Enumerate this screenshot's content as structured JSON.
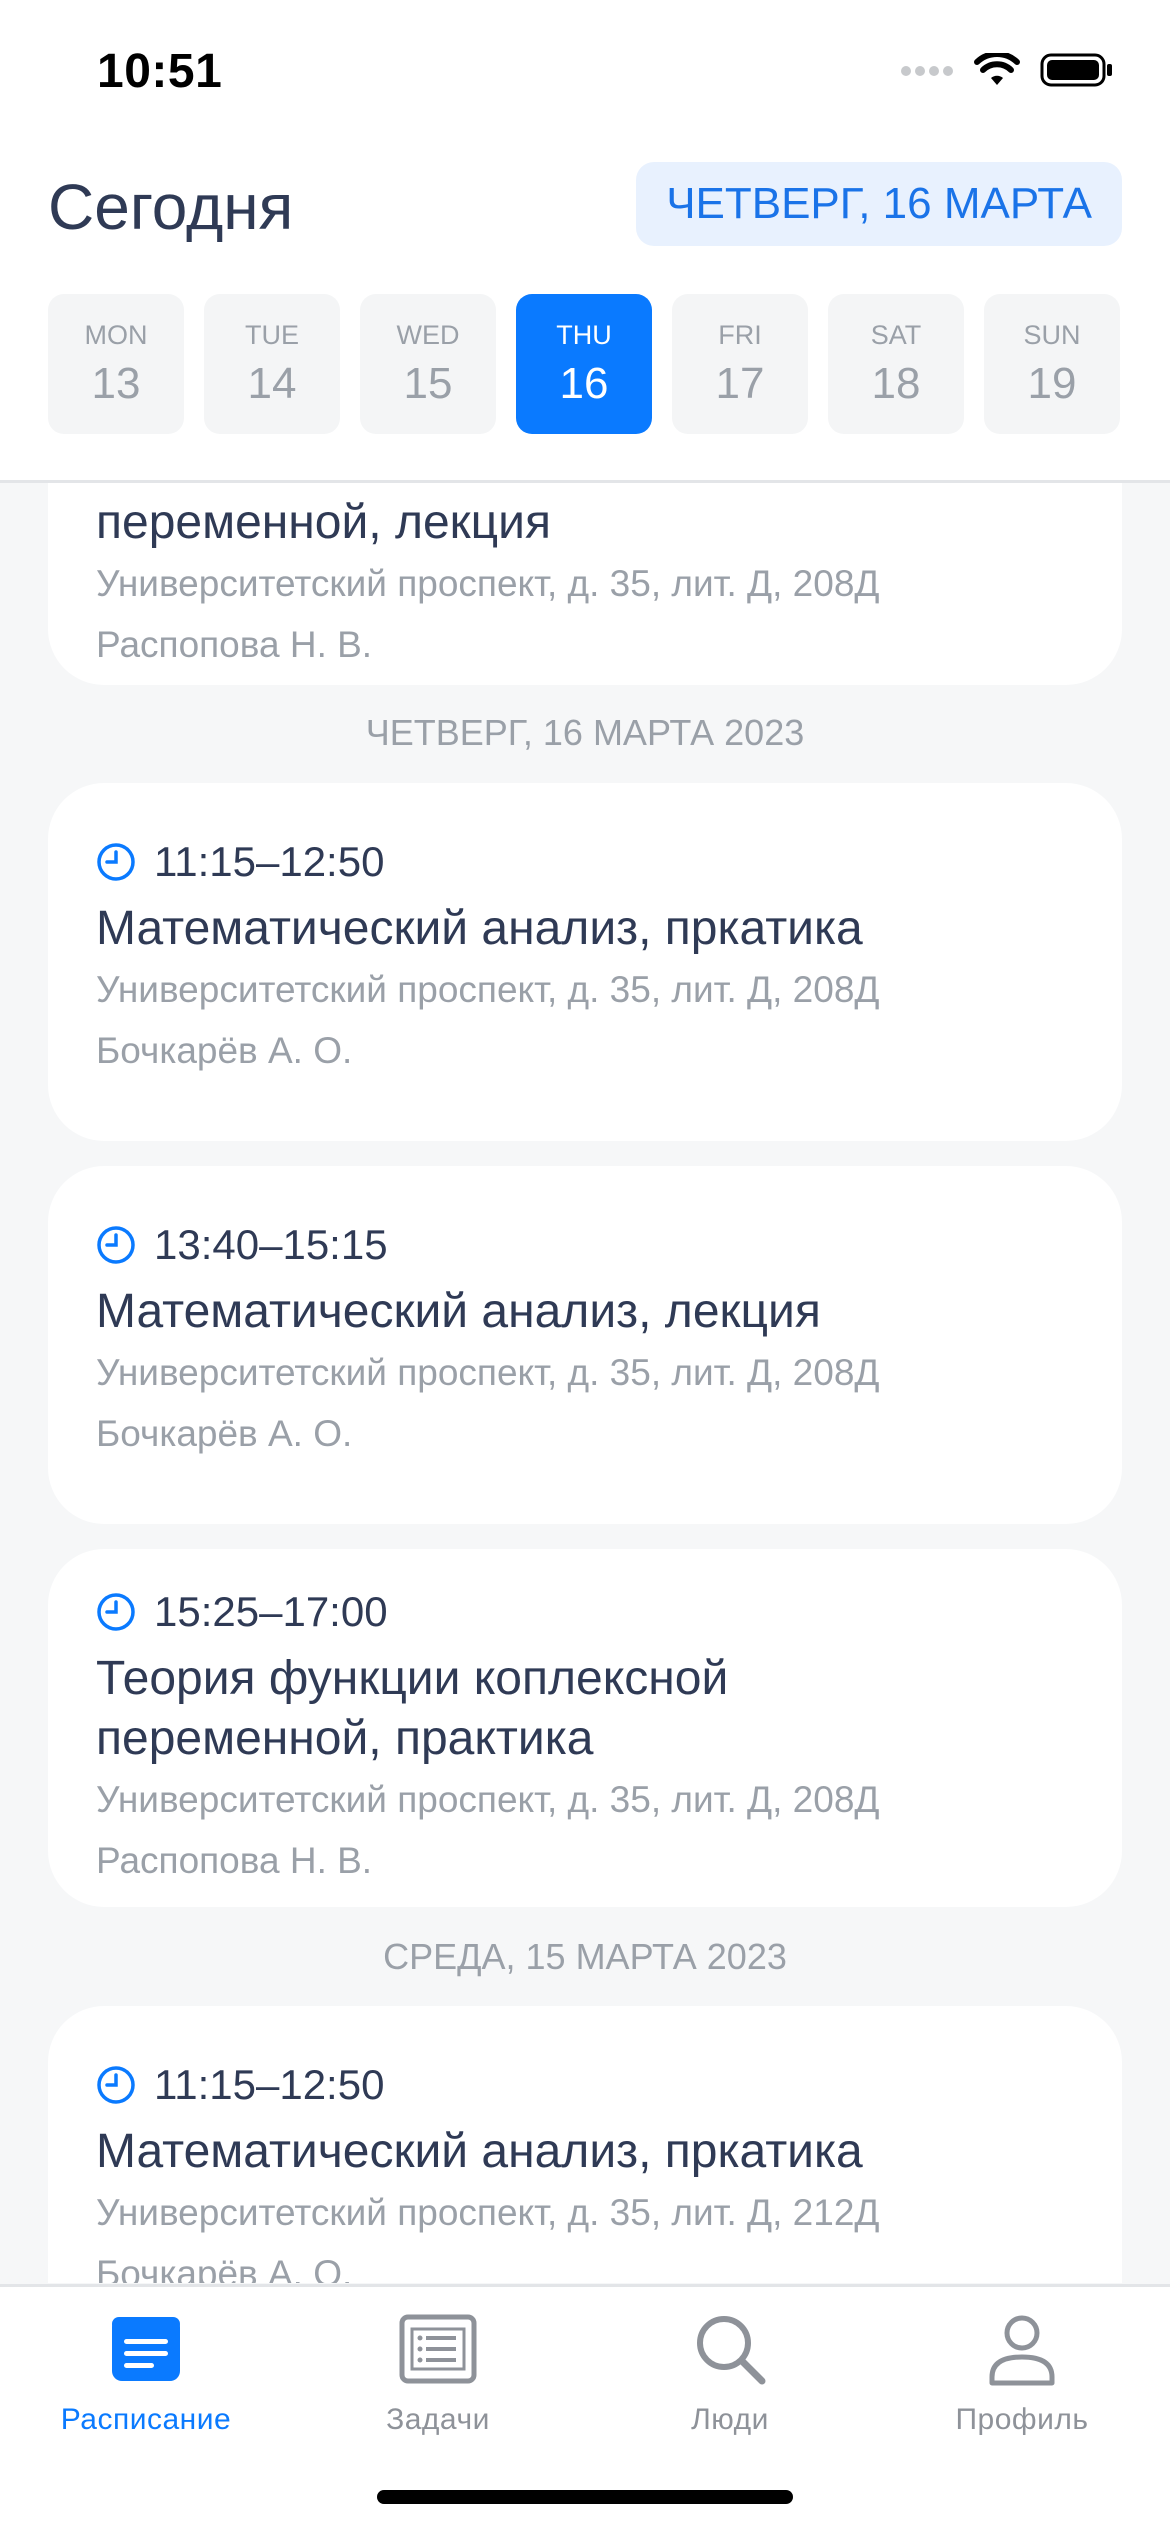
{
  "status": {
    "time": "10:51"
  },
  "header": {
    "title": "Сегодня",
    "date_pill": "ЧЕТВЕРГ, 16 МАРТА"
  },
  "week": [
    {
      "name": "MON",
      "num": "13"
    },
    {
      "name": "TUE",
      "num": "14"
    },
    {
      "name": "WED",
      "num": "15"
    },
    {
      "name": "THU",
      "num": "16",
      "active": true
    },
    {
      "name": "FRI",
      "num": "17"
    },
    {
      "name": "SAT",
      "num": "18"
    },
    {
      "name": "SUN",
      "num": "19"
    }
  ],
  "partial_card": {
    "subject_tail": "переменной, лекция",
    "location": "Университетский проспект, д. 35, лит. Д, 208Д",
    "teacher": "Распопова Н. В."
  },
  "days": [
    {
      "header": "ЧЕТВЕРГ, 16 МАРТА 2023",
      "lessons": [
        {
          "time": "11:15–12:50",
          "subject": [
            "Математический анализ, пркатика"
          ],
          "location": "Университетский проспект, д. 35, лит. Д, 208Д",
          "teacher": "Бочкарёв А. О."
        },
        {
          "time": "13:40–15:15",
          "subject": [
            "Математический анализ, лекция"
          ],
          "location": "Университетский проспект, д. 35, лит. Д, 208Д",
          "teacher": "Бочкарёв А. О."
        },
        {
          "time": "15:25–17:00",
          "subject": [
            "Теория функции коплексной",
            "переменной, практика"
          ],
          "location": "Университетский проспект, д. 35, лит. Д, 208Д",
          "teacher": "Распопова Н. В."
        }
      ]
    },
    {
      "header": "СРЕДА, 15 МАРТА 2023",
      "lessons": [
        {
          "time": "11:15–12:50",
          "subject": [
            "Математический анализ, пркатика"
          ],
          "location": "Университетский проспект, д. 35, лит. Д, 212Д",
          "teacher": "Бочкарёв А. О."
        }
      ]
    }
  ],
  "tabbar": {
    "tabs": [
      {
        "label": "Расписание",
        "icon": "schedule-icon",
        "active": true
      },
      {
        "label": "Задачи",
        "icon": "tasks-icon"
      },
      {
        "label": "Люди",
        "icon": "search-icon"
      },
      {
        "label": "Профиль",
        "icon": "profile-icon"
      }
    ]
  },
  "colors": {
    "accent": "#0A7AFF",
    "text": "#2F3A55",
    "muted": "#9AA0A8",
    "background": "#F6F7F8",
    "pill_bg": "#E8F1FE"
  }
}
